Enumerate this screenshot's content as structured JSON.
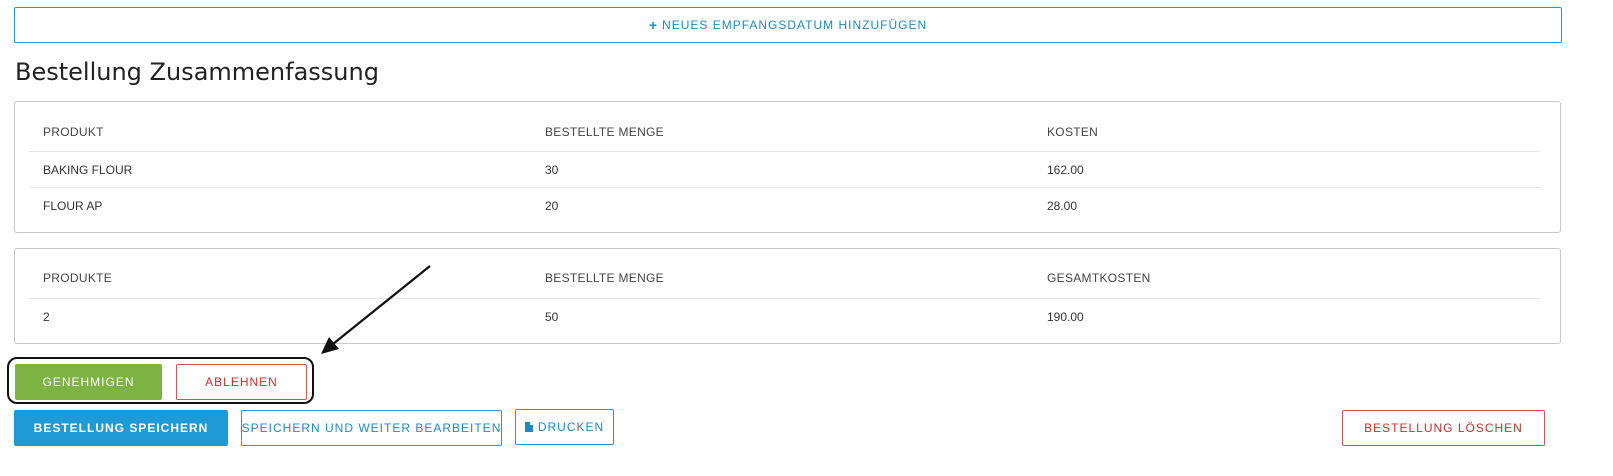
{
  "add_date": {
    "icon": "plus-icon",
    "label": "Neues Empfangsdatum hinzufügen"
  },
  "summary": {
    "title": "Bestellung Zusammenfassung",
    "items": {
      "headers": [
        "Produkt",
        "Bestellte Menge",
        "Kosten"
      ],
      "rows": [
        [
          "Baking Flour",
          "30",
          "162.00"
        ],
        [
          "Flour AP",
          "20",
          "28.00"
        ]
      ]
    },
    "totals": {
      "headers": [
        "Produkte",
        "Bestellte Menge",
        "Gesamtkosten"
      ],
      "row": [
        "2",
        "50",
        "190.00"
      ]
    }
  },
  "approval": {
    "approve_label": "Genehmigen",
    "reject_label": "Ablehnen"
  },
  "actions": {
    "save_label": "Bestellung speichern",
    "save_continue_label": "Speichern und weiter bearbeiten",
    "print_icon": "document-icon",
    "print_label": "Drucken",
    "delete_label": "Bestellung löschen"
  },
  "colors": {
    "accent": "#1e9ad6",
    "approve": "#7cb342",
    "danger": "#d9534f"
  }
}
